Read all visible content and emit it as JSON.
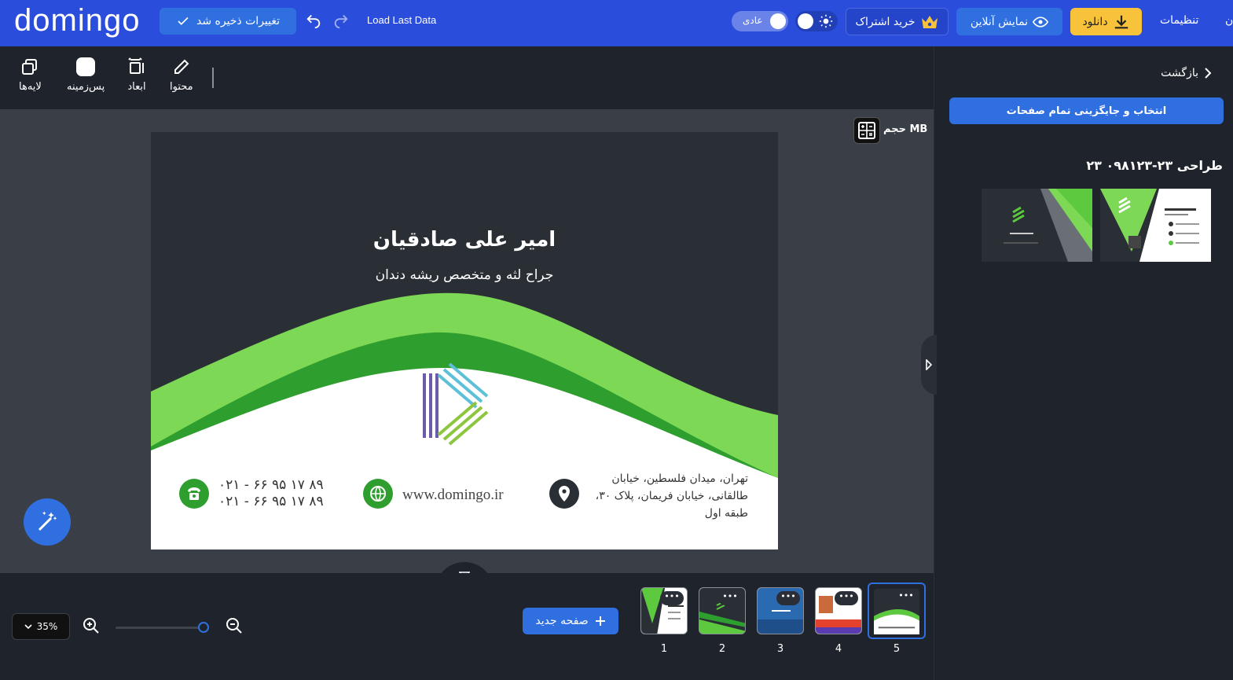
{
  "topbar": {
    "logo": "domingo",
    "saved_label": "تغییرات ذخیره شد",
    "load_last": "Load Last Data",
    "mode_label": "عادی",
    "subscribe_label": "خرید اشتراک",
    "preview_label": "نمایش آنلاین",
    "download_label": "دانلود",
    "settings_label": "تنظیمات",
    "edge_label": "ن"
  },
  "toolbar": {
    "layers": "لایه‌ها",
    "background": "پس‌زمینه",
    "dimensions": "ابعاد",
    "content": "محتوا"
  },
  "canvas": {
    "size_label": "حجم MB",
    "card": {
      "name": "امیر علی صادقیان",
      "title": "جراح لثه و متخصص ریشه دندان",
      "address_lines": [
        "تهران، میدان فلسطین، خیابان",
        "طالقانی، خیابان فریمان، پلاک ۳۰،",
        "طبقه اول"
      ],
      "website": "www.domingo.ir",
      "phone_1": "۰۲۱ - ۶۶ ۹۵ ۱۷ ۸۹",
      "phone_2": "۰۲۱ - ۶۶ ۹۵ ۱۷ ۸۹"
    }
  },
  "bottombar": {
    "zoom_level": "35%",
    "zoom_slider_fraction": 1.0,
    "new_page_label": "صفحه جدید",
    "pages": [
      "1",
      "2",
      "3",
      "4",
      "5"
    ],
    "active_page": 5,
    "dots": "•••"
  },
  "panel": {
    "back_label": "بازگشت",
    "replace_all_label": "انتخاب و جایگزینی تمام صفحات",
    "design_title": "طراحی ۲۳-۰۹۸۱۲۳ ۲۳"
  },
  "colors": {
    "topbar": "#2b4ddb",
    "accent": "#2f6fe0",
    "download": "#f8c33a",
    "card_dark": "#2a2f36",
    "card_green": "#5cc93f"
  }
}
